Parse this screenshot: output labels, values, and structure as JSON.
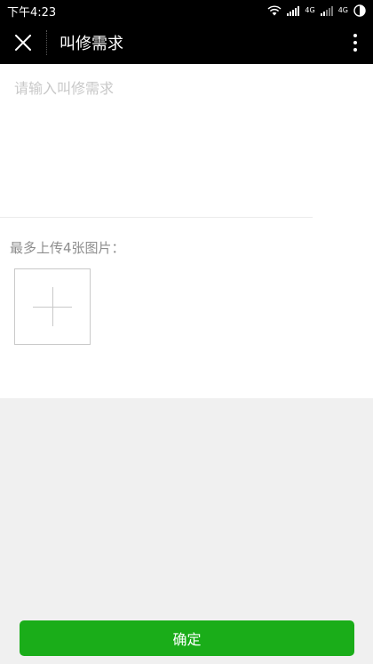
{
  "status_bar": {
    "time": "下午4:23",
    "net_label_1": "4G",
    "net_label_2": "4G"
  },
  "nav": {
    "title": "叫修需求"
  },
  "form": {
    "demand_placeholder": "请输入叫修需求",
    "demand_value": "",
    "upload_label": "最多上传4张图片："
  },
  "footer": {
    "confirm_label": "确定"
  },
  "colors": {
    "nav_bg": "#000000",
    "primary": "#1aad19",
    "page_bg": "#f0f0f0",
    "placeholder": "#c8c8c8"
  },
  "icons": {
    "close": "close-icon",
    "more": "more-vertical-icon",
    "add_image": "plus-icon"
  }
}
